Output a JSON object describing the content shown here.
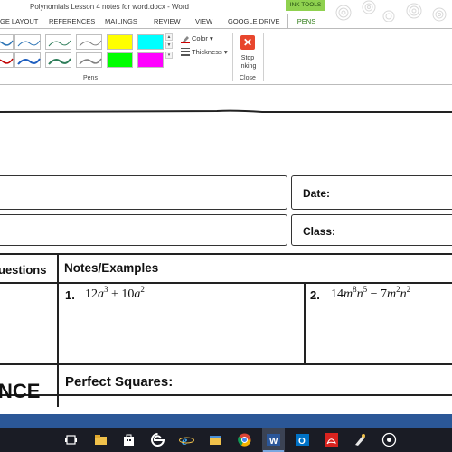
{
  "window": {
    "title": "Polynomials Lesson 4 notes for word.docx - Word"
  },
  "contextual_tab": {
    "label": "INK TOOLS",
    "color": "#8fd14f"
  },
  "tabs": [
    {
      "label": "GE LAYOUT"
    },
    {
      "label": "REFERENCES"
    },
    {
      "label": "MAILINGS"
    },
    {
      "label": "REVIEW"
    },
    {
      "label": "VIEW"
    },
    {
      "label": "GOOGLE DRIVE"
    },
    {
      "label": "PENS",
      "active": true
    }
  ],
  "ribbon": {
    "pens_group_label": "Pens",
    "close_group_label": "Close",
    "color_label": "Color",
    "thickness_label": "Thickness",
    "stop_inking_line1": "Stop",
    "stop_inking_line2": "Inking",
    "pen_colors": [
      "#2e75b6",
      "#2e75b6",
      "#2e7d59",
      "#7f7f7f",
      "#c00000",
      "#1f5fbf",
      "#2e7d59",
      "#7f7f7f"
    ],
    "highlighter_colors": [
      "#ffff00",
      "#00ffff",
      "#00ff00",
      "#ff00ff"
    ]
  },
  "document": {
    "date_label": "Date:",
    "class_label": "Class:",
    "questions_header": "uestions",
    "notes_header": "Notes/Examples",
    "example1_number": "1.",
    "example2_number": "2.",
    "nce_label": "NCE",
    "perfect_squares_label": "Perfect Squares:"
  },
  "taskbar": {
    "icons": [
      "task-view-icon",
      "file-explorer-icon",
      "store-icon",
      "edge-icon",
      "ie-icon",
      "folder-icon",
      "chrome-icon",
      "word-icon",
      "outlook-icon",
      "acrobat-icon",
      "paint-icon",
      "media-icon"
    ]
  }
}
